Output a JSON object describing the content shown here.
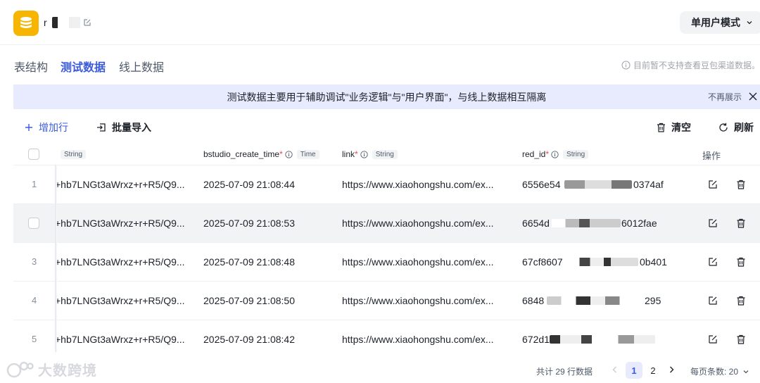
{
  "header": {
    "app_name": "r",
    "mode_label": "单用户模式"
  },
  "tabs": [
    {
      "label": "表结构"
    },
    {
      "label": "测试数据"
    },
    {
      "label": "线上数据"
    }
  ],
  "notice": "目前暂不支持查看豆包渠道数据。",
  "banner": {
    "text": "测试数据主要用于辅助调试\"业务逻辑\"与\"用户界面\"，与线上数据相互隔离",
    "hide_label": "不再展示"
  },
  "toolbar": {
    "add_row": "增加行",
    "batch_import": "批量导入",
    "clear": "清空",
    "refresh": "刷新"
  },
  "table": {
    "columns": [
      {
        "name": "",
        "type": "String"
      },
      {
        "name": "bstudio_create_time",
        "type": "Time"
      },
      {
        "name": "link",
        "type": "String"
      },
      {
        "name": "red_id",
        "type": "String"
      }
    ],
    "ops_header": "操作",
    "rows": [
      {
        "num": "1",
        "c0": "+hb7LNGt3aWrxz+r+R5/Q9...",
        "time": "2025-07-09 21:08:44",
        "link": "https://www.xiaohongshu.com/ex...",
        "red_id": "6556e54",
        "red_id_tail": "0374af"
      },
      {
        "num": "",
        "c0": "+hb7LNGt3aWrxz+r+R5/Q9...",
        "time": "2025-07-09 21:08:53",
        "link": "https://www.xiaohongshu.com/ex...",
        "red_id": "6654d",
        "red_id_tail": "6012fae"
      },
      {
        "num": "3",
        "c0": "+hb7LNGt3aWrxz+r+R5/Q9...",
        "time": "2025-07-09 21:08:48",
        "link": "https://www.xiaohongshu.com/ex...",
        "red_id": "67cf8607",
        "red_id_tail": "0b401"
      },
      {
        "num": "4",
        "c0": "+hb7LNGt3aWrxz+r+R5/Q9...",
        "time": "2025-07-09 21:08:50",
        "link": "https://www.xiaohongshu.com/ex...",
        "red_id": "6848",
        "red_id_tail": "295"
      },
      {
        "num": "5",
        "c0": "+hb7LNGt3aWrxz+r+R5/Q9...",
        "time": "2025-07-09 21:08:42",
        "link": "https://www.xiaohongshu.com/ex...",
        "red_id": "672d1",
        "red_id_tail": ""
      }
    ]
  },
  "footer": {
    "watermark": "大数跨境",
    "total": "共计 29 行数据",
    "pages": [
      "1",
      "2"
    ],
    "page_size": "每页条数: 20"
  },
  "colors": {
    "accent": "#3b5bdb",
    "logo": "#f7b500",
    "banner_bg": "#e8eafd",
    "required": "#e5484d"
  }
}
